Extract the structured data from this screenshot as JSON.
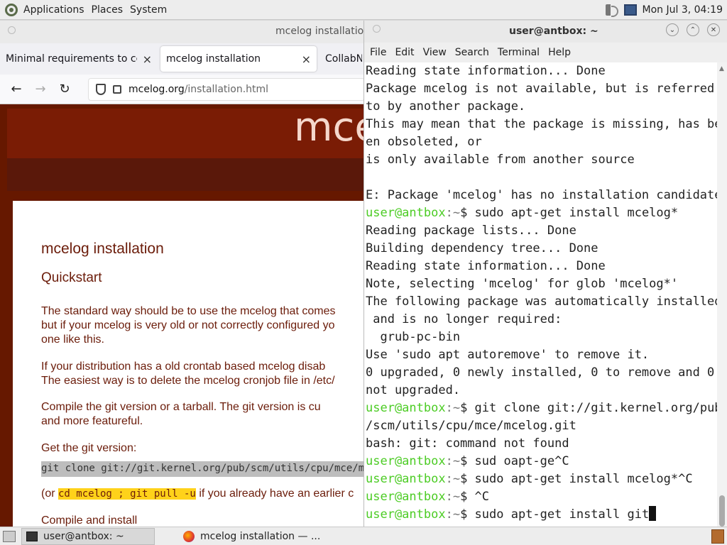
{
  "top_panel": {
    "menu": [
      "Applications",
      "Places",
      "System"
    ],
    "clock": "Mon Jul 3, 04:19"
  },
  "firefox": {
    "window_title": "mcelog installation",
    "tabs": [
      {
        "label": "Minimal requirements to con",
        "active": false
      },
      {
        "label": "mcelog installation",
        "active": true
      },
      {
        "label": "CollabN",
        "active": false
      }
    ],
    "url_host": "mcelog.org",
    "url_path": "/installation.html",
    "page": {
      "site_header": "mce",
      "heading": "mcelog installation",
      "subheading": "Quickstart",
      "p1_l1": "The standard way should be to use the mcelog that comes",
      "p1_l2": "but if your mcelog is very old or not correctly configured yo",
      "p1_l3": "one like this.",
      "p2_l1": "If your distribution has a old crontab based mcelog disab",
      "p2_l2": "The easiest way is to delete the mcelog cronjob file in /etc/",
      "p3_l1": "Compile the git version or a tarball. The git version is cu",
      "p3_l2": "and more featureful.",
      "p4": "Get the git version:",
      "code": "git clone git://git.kernel.org/pub/scm/utils/cpu/mce/mcelo",
      "p5_pre": "(or ",
      "p5_code": "cd mcelog ; git pull -u",
      "p5_post": " if you already have an earlier c",
      "p6": "Compile and install"
    }
  },
  "terminal": {
    "title": "user@antbox: ~",
    "menu": [
      "File",
      "Edit",
      "View",
      "Search",
      "Terminal",
      "Help"
    ],
    "prompt_user": "user@antbox",
    "prompt_sep": ":~",
    "lines": [
      {
        "type": "out",
        "text": "Reading state information... Done"
      },
      {
        "type": "out",
        "text": "Package mcelog is not available, but is referred"
      },
      {
        "type": "out",
        "text": "to by another package."
      },
      {
        "type": "out",
        "text": "This may mean that the package is missing, has be"
      },
      {
        "type": "out",
        "text": "en obsoleted, or"
      },
      {
        "type": "out",
        "text": "is only available from another source"
      },
      {
        "type": "out",
        "text": ""
      },
      {
        "type": "out",
        "text": "E: Package 'mcelog' has no installation candidate"
      },
      {
        "type": "cmd",
        "text": "$ sudo apt-get install mcelog*"
      },
      {
        "type": "out",
        "text": "Reading package lists... Done"
      },
      {
        "type": "out",
        "text": "Building dependency tree... Done"
      },
      {
        "type": "out",
        "text": "Reading state information... Done"
      },
      {
        "type": "out",
        "text": "Note, selecting 'mcelog' for glob 'mcelog*'"
      },
      {
        "type": "out",
        "text": "The following package was automatically installed"
      },
      {
        "type": "out",
        "text": " and is no longer required:"
      },
      {
        "type": "out",
        "text": "  grub-pc-bin"
      },
      {
        "type": "out",
        "text": "Use 'sudo apt autoremove' to remove it."
      },
      {
        "type": "out",
        "text": "0 upgraded, 0 newly installed, 0 to remove and 0"
      },
      {
        "type": "out",
        "text": "not upgraded."
      },
      {
        "type": "cmd",
        "text": "$ git clone git://git.kernel.org/pub"
      },
      {
        "type": "out",
        "text": "/scm/utils/cpu/mce/mcelog.git"
      },
      {
        "type": "out",
        "text": "bash: git: command not found"
      },
      {
        "type": "cmd",
        "text": "$ sud oapt-ge^C"
      },
      {
        "type": "cmd",
        "text": "$ sudo apt-get install mcelog*^C"
      },
      {
        "type": "cmd",
        "text": "$ ^C"
      },
      {
        "type": "cmd_cursor",
        "text": "$ sudo apt-get install git"
      }
    ]
  },
  "taskbar": {
    "tasks": [
      {
        "label": "user@antbox: ~",
        "icon": "terminal-icon"
      },
      {
        "label": "mcelog installation — ...",
        "icon": "firefox-icon"
      }
    ]
  }
}
